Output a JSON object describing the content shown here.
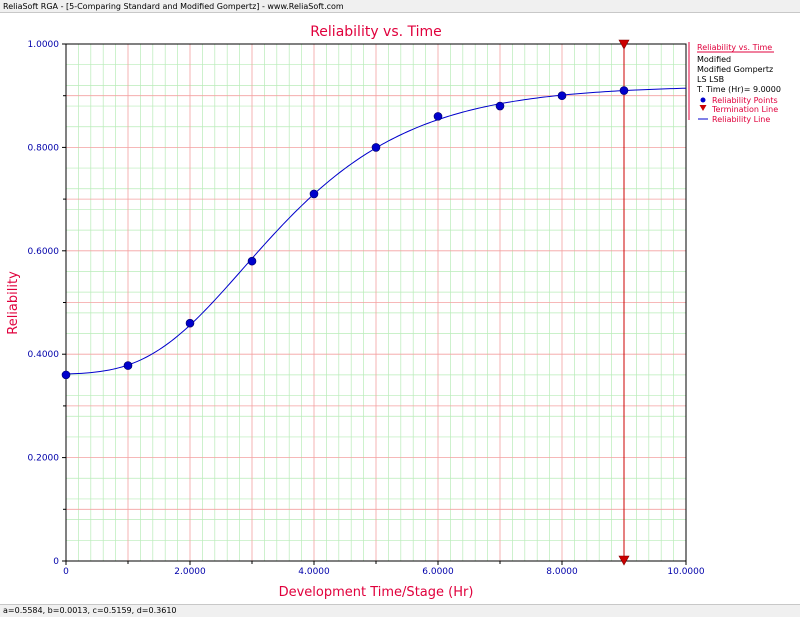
{
  "window": {
    "title": "ReliaSoft RGA - [5-Comparing Standard and Modified Gompertz] - www.ReliaSoft.com"
  },
  "status": {
    "params": "a=0.5584, b=0.0013, c=0.5159, d=0.3610"
  },
  "legend": {
    "title": "Reliability vs. Time",
    "lines": [
      "Modified",
      "Modified Gompertz",
      "LS LSB",
      "T. Time (Hr)= 9.0000"
    ],
    "items": [
      "Reliability Points",
      "Termination Line",
      "Reliability Line"
    ]
  },
  "colors": {
    "accent": "#e0003c",
    "points": "#0000cc",
    "line": "#0000cc",
    "termination": "#cc0000",
    "major_grid": "#f4a0a0",
    "minor_grid": "#b8ecb8"
  },
  "chart_data": {
    "type": "line",
    "title": "Reliability vs. Time",
    "xlabel": "Development Time/Stage (Hr)",
    "ylabel": "Reliability",
    "xlim": [
      0,
      10
    ],
    "ylim": [
      0,
      1
    ],
    "x_ticks": [
      {
        "value": 0,
        "label": "0"
      },
      {
        "value": 2,
        "label": "2.0000"
      },
      {
        "value": 4,
        "label": "4.0000"
      },
      {
        "value": 6,
        "label": "6.0000"
      },
      {
        "value": 8,
        "label": "8.0000"
      },
      {
        "value": 10,
        "label": "10.0000"
      }
    ],
    "y_ticks": [
      {
        "value": 0,
        "label": "0"
      },
      {
        "value": 0.2,
        "label": "0.2000"
      },
      {
        "value": 0.4,
        "label": "0.4000"
      },
      {
        "value": 0.6,
        "label": "0.6000"
      },
      {
        "value": 0.8,
        "label": "0.8000"
      },
      {
        "value": 1.0,
        "label": "1.0000"
      }
    ],
    "grid": true,
    "legend_position": "right",
    "series": [
      {
        "name": "Reliability Points",
        "kind": "scatter",
        "x": [
          0,
          1,
          2,
          3,
          4,
          5,
          6,
          7,
          8,
          9
        ],
        "y": [
          0.36,
          0.378,
          0.46,
          0.58,
          0.71,
          0.8,
          0.86,
          0.88,
          0.9,
          0.91
        ]
      },
      {
        "name": "Reliability Line",
        "kind": "line",
        "model": "modified_gompertz",
        "params": {
          "a": 0.5584,
          "b": 0.0013,
          "c": 0.5159,
          "d": 0.361
        }
      },
      {
        "name": "Termination Line",
        "kind": "vline",
        "x": 9.0
      }
    ]
  }
}
